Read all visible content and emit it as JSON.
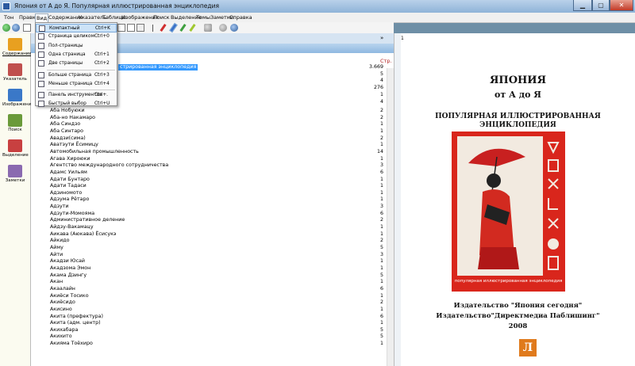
{
  "window": {
    "title": "Япония от А до Я. Популярная иллюстрированная энциклопедия"
  },
  "menu": [
    "Тон",
    "Правка",
    "Вид",
    "Содержание",
    "Указатель",
    "Таблицы",
    "Изображения",
    "Поиск",
    "Выделение",
    "Темы",
    "Заметки",
    "Справка"
  ],
  "view_menu": [
    {
      "label": "Компактный",
      "shortcut": "Ctrl+K",
      "icon": "compact-view-icon",
      "highlight": true
    },
    {
      "label": "Страница целиком",
      "shortcut": "Ctrl+0",
      "icon": "full-page-icon"
    },
    {
      "label": "Пол-страницы",
      "shortcut": "",
      "icon": "half-page-icon"
    },
    {
      "label": "Одна страница",
      "shortcut": "Ctrl+1",
      "icon": "one-page-icon"
    },
    {
      "label": "Две страницы",
      "shortcut": "Ctrl+2",
      "icon": "two-pages-icon",
      "sep_after": true
    },
    {
      "label": "Больше страница",
      "shortcut": "Ctrl+3",
      "icon": "larger-page-icon"
    },
    {
      "label": "Меньше страница",
      "shortcut": "Ctrl+4",
      "icon": "smaller-page-icon",
      "sep_after": true
    },
    {
      "label": "Панель инструментов",
      "shortcut": "Ctrl+.",
      "icon": "toolbar-icon"
    },
    {
      "label": "Быстрый выбор",
      "shortcut": "Ctrl+U",
      "icon": "quick-select-icon"
    }
  ],
  "sidebar": [
    {
      "label": "Содержание",
      "icon": "contents-icon",
      "color": "#e8a020"
    },
    {
      "label": "Указатель",
      "icon": "index-icon",
      "color": "#c0504d"
    },
    {
      "label": "Изображения",
      "icon": "images-icon",
      "color": "#3a78c8"
    },
    {
      "label": "Поиск",
      "icon": "search-icon",
      "color": "#6a9a3a"
    },
    {
      "label": "Выделение",
      "icon": "highlight-icon",
      "color": "#c84040"
    },
    {
      "label": "Заметки",
      "icon": "notes-icon",
      "color": "#8a6ab0"
    }
  ],
  "list": {
    "page_header": "Стр.",
    "selected_label": "стрированная энциклопедия",
    "top_pages": [
      "3.669",
      "5",
      "4",
      "276",
      "1",
      "4"
    ],
    "rows": [
      {
        "name": "Аба Нобуюки",
        "page": "2"
      },
      {
        "name": "Аба-но Накамаро",
        "page": "2"
      },
      {
        "name": "Аба Синдзо",
        "page": "1"
      },
      {
        "name": "Аба Синтаро",
        "page": "1"
      },
      {
        "name": "Авадзи(сима)",
        "page": "2"
      },
      {
        "name": "Аватэути Ёсимицу",
        "page": "1"
      },
      {
        "name": "Автомобильная промышленность",
        "page": "14"
      },
      {
        "name": "Агава Хироюки",
        "page": "1"
      },
      {
        "name": "Агентство международного сотрудничества",
        "page": "3"
      },
      {
        "name": "Адамс Уильям",
        "page": "6"
      },
      {
        "name": "Адати Бунтаро",
        "page": "1"
      },
      {
        "name": "Адати Тадаси",
        "page": "1"
      },
      {
        "name": "Адзиномото",
        "page": "1"
      },
      {
        "name": "Адзума Рётаро",
        "page": "1"
      },
      {
        "name": "Адзути",
        "page": "3"
      },
      {
        "name": "Адзути-Момояма",
        "page": "6"
      },
      {
        "name": "Административное деление",
        "page": "2"
      },
      {
        "name": "Айдзу-Вакамацу",
        "page": "1"
      },
      {
        "name": "Аикава (Аюкава) Ёсисукэ",
        "page": "1"
      },
      {
        "name": "Айкидо",
        "page": "2"
      },
      {
        "name": "Айму",
        "page": "5"
      },
      {
        "name": "Айти",
        "page": "3"
      },
      {
        "name": "Акадзи Юсай",
        "page": "1"
      },
      {
        "name": "Акадзома Эмон",
        "page": "1"
      },
      {
        "name": "Акама Дзингу",
        "page": "5"
      },
      {
        "name": "Акан",
        "page": "1"
      },
      {
        "name": "Акаалайн",
        "page": "6"
      },
      {
        "name": "Акиёси Тосико",
        "page": "1"
      },
      {
        "name": "Акиёсидо",
        "page": "2"
      },
      {
        "name": "Акисино",
        "page": "1"
      },
      {
        "name": "Акита (префектура)",
        "page": "6"
      },
      {
        "name": "Акита (адм. центр)",
        "page": "1"
      },
      {
        "name": "Акихабара",
        "page": "5"
      },
      {
        "name": "Акихито",
        "page": "5"
      },
      {
        "name": "Акияма Тоёхиро",
        "page": "1"
      }
    ]
  },
  "doc": {
    "page_marker": "1",
    "title1": "ЯПОНИЯ",
    "title2": "от А до Я",
    "subtitle": "ПОПУЛЯРНАЯ ИЛЛЮСТРИРОВАННАЯ ЭНЦИКЛОПЕДИЯ",
    "cover_title": "ЯПОНИЯ от А до Я",
    "cover_caption": "популярная иллюстрированная энциклопедия",
    "publisher1": "Издательство \"Япония сегодня\"",
    "publisher2": "Издательство\"Директмедиа Паблишинг\"",
    "year": "2008"
  },
  "watermark": "Л"
}
